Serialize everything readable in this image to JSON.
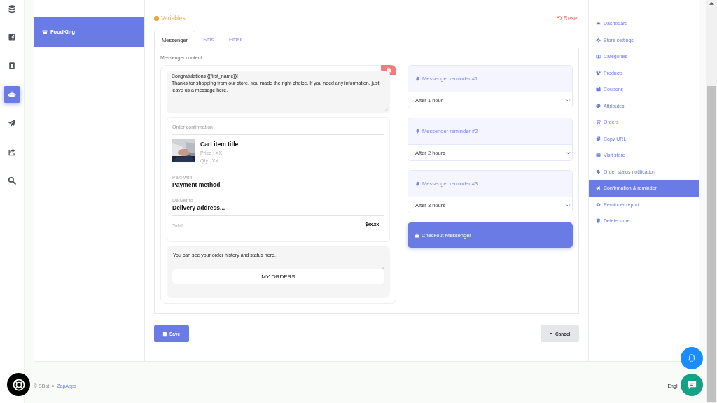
{
  "rail": [
    {
      "selected": false
    },
    {
      "selected": false
    },
    {
      "selected": false
    },
    {
      "selected": true
    },
    {
      "selected": false
    },
    {
      "selected": false
    },
    {
      "selected": false
    }
  ],
  "stores": [
    {
      "label": "FoodKing",
      "selected": true
    }
  ],
  "variables_link": "Variables",
  "reset_link": "Reset",
  "tabs": [
    {
      "label": "Messenger",
      "selected": true
    },
    {
      "label": "Sms",
      "selected": false
    },
    {
      "label": "Email",
      "selected": false
    }
  ],
  "content_label": "Messenger content",
  "message": "Congratulations {{first_name}}!\nThanks for shopping from our store. You made the right choice. If you need any information, just leave us a message here.",
  "order": {
    "title": "Order confirmation",
    "item_title": "Cart item title",
    "price": "Price : XX",
    "qty": "Qty : XX",
    "paid_label": "Paid with",
    "payment": "Payment method",
    "deliver_label": "Deliver to",
    "address": "Delivery address...",
    "total_label": "Total",
    "total": "$xx.xx"
  },
  "footer_message": "You can see your order history and status here.",
  "footer_button": "MY ORDERS",
  "reminders": [
    {
      "title": "Messenger reminder #1",
      "value": "After 1 hour"
    },
    {
      "title": "Messenger reminder #2",
      "value": "After 2 hours"
    },
    {
      "title": "Messenger reminder #3",
      "value": "After 3 hours"
    }
  ],
  "checkout_button": "Checkout Messenger",
  "save_button": "Save",
  "cancel_button": "Cancel",
  "nav": [
    {
      "label": "Dashboard",
      "selected": false
    },
    {
      "label": "Store settings",
      "selected": false
    },
    {
      "label": "Categories",
      "selected": false
    },
    {
      "label": "Products",
      "selected": false
    },
    {
      "label": "Coupons",
      "selected": false
    },
    {
      "label": "Attributes",
      "selected": false
    },
    {
      "label": "Orders",
      "selected": false
    },
    {
      "label": "Copy URL",
      "selected": false
    },
    {
      "label": "Visit store",
      "selected": false
    },
    {
      "label": "Order status notification",
      "selected": false
    },
    {
      "label": "Confirmation & reminder",
      "selected": true
    },
    {
      "label": "Reminder report",
      "selected": false
    },
    {
      "label": "Delete store",
      "selected": false
    }
  ],
  "footer": {
    "copyright": "© SBot",
    "brand": "ZapApps",
    "language": "Engli"
  }
}
